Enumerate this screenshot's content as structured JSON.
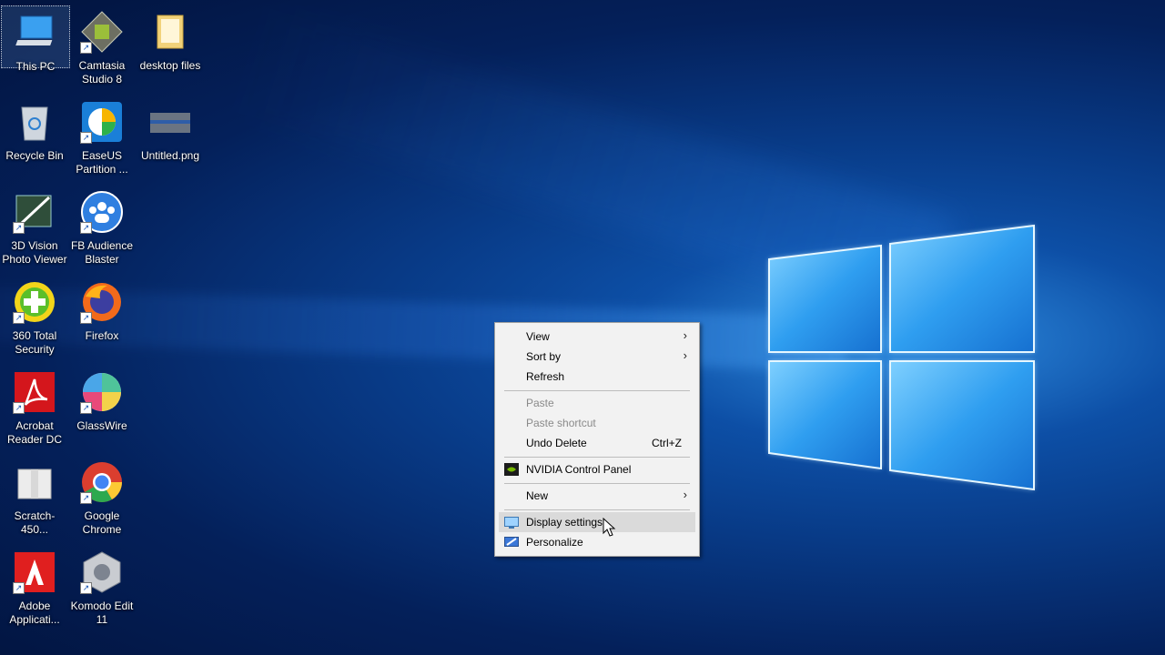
{
  "desktop": {
    "icons": [
      {
        "name": "this-pc",
        "label": "This PC"
      },
      {
        "name": "camtasia",
        "label": "Camtasia Studio 8"
      },
      {
        "name": "desktop-files",
        "label": "desktop files"
      },
      {
        "name": "recycle-bin",
        "label": "Recycle Bin"
      },
      {
        "name": "easeus",
        "label": "EaseUS Partition ..."
      },
      {
        "name": "untitled-png",
        "label": "Untitled.png"
      },
      {
        "name": "3d-vision",
        "label": "3D Vision Photo Viewer"
      },
      {
        "name": "fb-audience",
        "label": "FB Audience Blaster"
      },
      {
        "name": "360-total",
        "label": "360 Total Security"
      },
      {
        "name": "firefox",
        "label": "Firefox"
      },
      {
        "name": "acrobat",
        "label": "Acrobat Reader DC"
      },
      {
        "name": "glasswire",
        "label": "GlassWire"
      },
      {
        "name": "scratch",
        "label": "Scratch-450..."
      },
      {
        "name": "chrome",
        "label": "Google Chrome"
      },
      {
        "name": "adobe-app",
        "label": "Adobe Applicati..."
      },
      {
        "name": "komodo",
        "label": "Komodo Edit 11"
      }
    ]
  },
  "context_menu": {
    "view": "View",
    "sort_by": "Sort by",
    "refresh": "Refresh",
    "paste": "Paste",
    "paste_shortcut": "Paste shortcut",
    "undo_delete": "Undo Delete",
    "undo_shortcut": "Ctrl+Z",
    "nvidia": "NVIDIA Control Panel",
    "new": "New",
    "display_settings": "Display settings",
    "personalize": "Personalize"
  },
  "colors": {
    "wallpaper_dark": "#02143f",
    "wallpaper_light": "#2f8de0",
    "menu_bg": "#f2f2f2",
    "menu_hover": "#dadada"
  }
}
